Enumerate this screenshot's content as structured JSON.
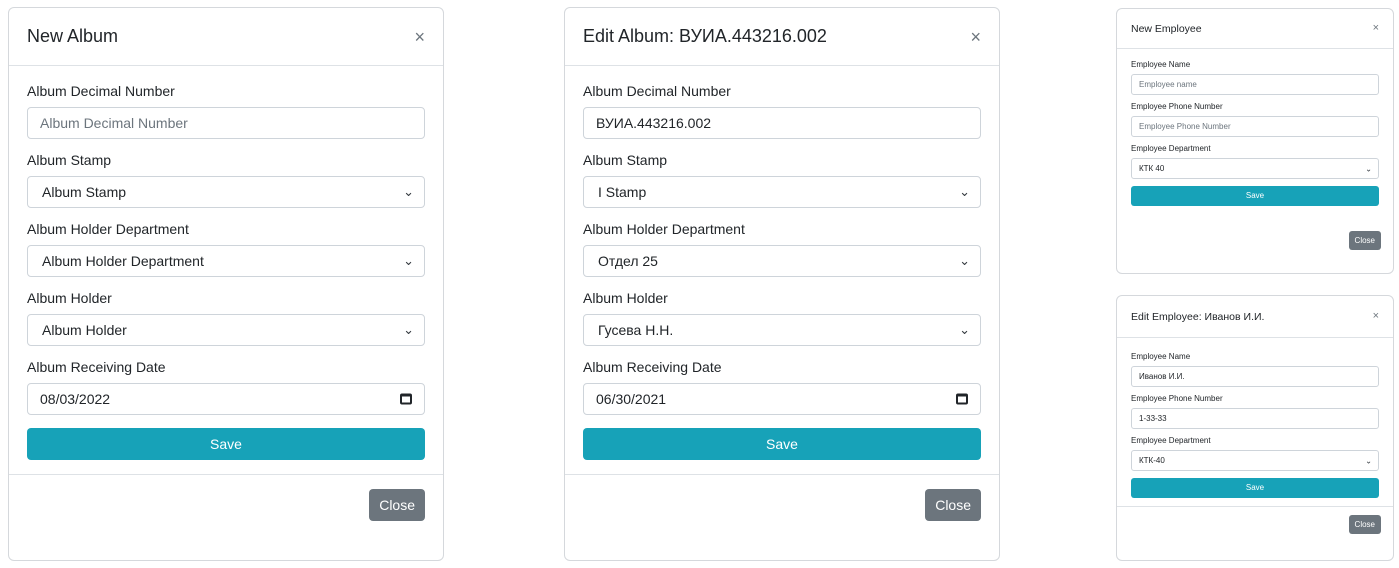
{
  "new_album": {
    "title": "New Album",
    "close_x": "×",
    "fields": {
      "decimal_label": "Album Decimal Number",
      "decimal_placeholder": "Album Decimal Number",
      "stamp_label": "Album Stamp",
      "stamp_value": "Album Stamp",
      "dept_label": "Album Holder Department",
      "dept_value": "Album Holder Department",
      "holder_label": "Album Holder",
      "holder_value": "Album Holder",
      "date_label": "Album Receiving Date",
      "date_value": "08/03/2022"
    },
    "save_label": "Save",
    "close_label": "Close"
  },
  "edit_album": {
    "title": "Edit Album: ВУИА.443216.002",
    "close_x": "×",
    "fields": {
      "decimal_label": "Album Decimal Number",
      "decimal_value": "ВУИА.443216.002",
      "stamp_label": "Album Stamp",
      "stamp_value": "I Stamp",
      "dept_label": "Album Holder Department",
      "dept_value": "Отдел 25",
      "holder_label": "Album Holder",
      "holder_value": "Гусева Н.Н.",
      "date_label": "Album Receiving Date",
      "date_value": "06/30/2021"
    },
    "save_label": "Save",
    "close_label": "Close"
  },
  "new_employee": {
    "title": "New Employee",
    "close_x": "×",
    "fields": {
      "name_label": "Employee Name",
      "name_placeholder": "Employee name",
      "phone_label": "Employee Phone Number",
      "phone_placeholder": "Employee Phone Number",
      "dept_label": "Employee Department",
      "dept_value": "КТК 40"
    },
    "save_label": "Save",
    "close_label": "Close"
  },
  "edit_employee": {
    "title": "Edit Employee: Иванов И.И.",
    "close_x": "×",
    "fields": {
      "name_label": "Employee Name",
      "name_value": "Иванов И.И.",
      "phone_label": "Employee Phone Number",
      "phone_value": "1-33-33",
      "dept_label": "Employee Department",
      "dept_value": "КТК-40"
    },
    "save_label": "Save",
    "close_label": "Close"
  },
  "icons": {
    "chevron": "chevron-down-icon",
    "calendar": "calendar-icon"
  },
  "colors": {
    "save_button": "#17a2b8",
    "close_button": "#6c757d"
  }
}
